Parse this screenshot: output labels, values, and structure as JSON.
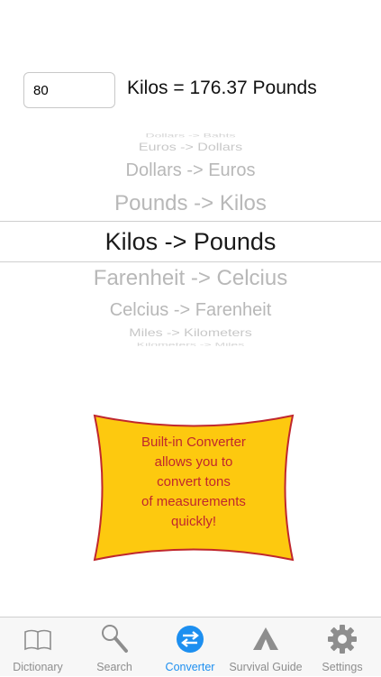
{
  "converter": {
    "amount_value": "80",
    "result": "Kilos = 176.37 Pounds"
  },
  "picker": {
    "items": [
      "Dollars -> Bahts",
      "Euros -> Dollars",
      "Dollars -> Euros",
      "Pounds -> Kilos",
      "Kilos -> Pounds",
      "Farenheit -> Celcius",
      "Celcius -> Farenheit",
      "Miles -> Kilometers",
      "Kilometers -> Miles"
    ],
    "selected": "Kilos -> Pounds"
  },
  "callout": {
    "lines": [
      "Built-in Converter",
      "allows you to",
      "convert tons",
      "of measurements",
      "quickly!"
    ],
    "fill_color": "#fdc90f",
    "border_color": "#c0272d"
  },
  "tabbar": {
    "active_color": "#1d8ff0",
    "inactive_color": "#8e8e8e",
    "tabs": [
      {
        "label": "Dictionary",
        "icon": "book-icon"
      },
      {
        "label": "Search",
        "icon": "magnifier-icon"
      },
      {
        "label": "Converter",
        "icon": "convert-arrows-icon",
        "active": true
      },
      {
        "label": "Survival Guide",
        "icon": "tent-icon"
      },
      {
        "label": "Settings",
        "icon": "gear-icon"
      }
    ]
  }
}
